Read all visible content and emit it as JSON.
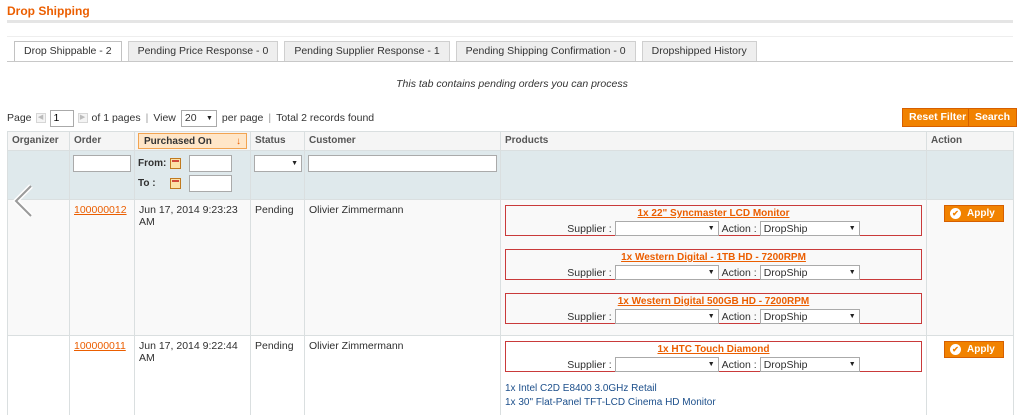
{
  "page": {
    "title": "Drop Shipping"
  },
  "tabs": [
    {
      "label": "Drop Shippable - 2",
      "active": true
    },
    {
      "label": "Pending Price Response - 0"
    },
    {
      "label": "Pending Supplier Response - 1"
    },
    {
      "label": "Pending Shipping Confirmation - 0"
    },
    {
      "label": "Dropshipped History"
    }
  ],
  "tab_note": "This tab contains pending orders you can process",
  "pager": {
    "page_label": "Page",
    "page_value": "1",
    "of_pages": "of 1 pages",
    "view_label": "View",
    "per_page_value": "20",
    "per_page_label": "per page",
    "total": "Total 2 records found"
  },
  "buttons": {
    "reset_filter": "Reset Filter",
    "search": "Search",
    "apply": "Apply"
  },
  "columns": [
    "Organizer",
    "Order",
    "Purchased On",
    "Status",
    "Customer",
    "Products",
    "Action"
  ],
  "filters": {
    "from_label": "From:",
    "to_label": "To :"
  },
  "orders": [
    {
      "id": "100000012",
      "date": "Jun 17, 2014 9:23:23 AM",
      "status": "Pending",
      "customer": "Olivier Zimmermann",
      "products": [
        {
          "name": "1x 22\" Syncmaster LCD Monitor",
          "supplier_label": "Supplier :",
          "action_label": "Action :",
          "action_value": "DropShip"
        },
        {
          "name": "1x Western Digital - 1TB HD - 7200RPM",
          "supplier_label": "Supplier :",
          "action_label": "Action :",
          "action_value": "DropShip"
        },
        {
          "name": "1x Western Digital 500GB HD - 7200RPM",
          "supplier_label": "Supplier :",
          "action_label": "Action :",
          "action_value": "DropShip"
        }
      ]
    },
    {
      "id": "100000011",
      "date": "Jun 17, 2014 9:22:44 AM",
      "status": "Pending",
      "customer": "Olivier Zimmermann",
      "products": [
        {
          "name": "1x HTC Touch Diamond",
          "supplier_label": "Supplier :",
          "action_label": "Action :",
          "action_value": "DropShip"
        }
      ],
      "extra_items": [
        "1x Intel C2D E8400 3.0GHz Retail",
        "1x 30\" Flat-Panel TFT-LCD Cinema HD Monitor"
      ]
    }
  ],
  "icons": {
    "calendar": "calendar-icon",
    "apply": "check-circle-icon",
    "nav": "chevron-left-icon",
    "sort": "arrow-down-icon"
  },
  "colors": {
    "accent": "#eb5e00",
    "button": "#f18200",
    "product_border": "#c93a3a",
    "filter_bg": "#dfe9ec"
  }
}
